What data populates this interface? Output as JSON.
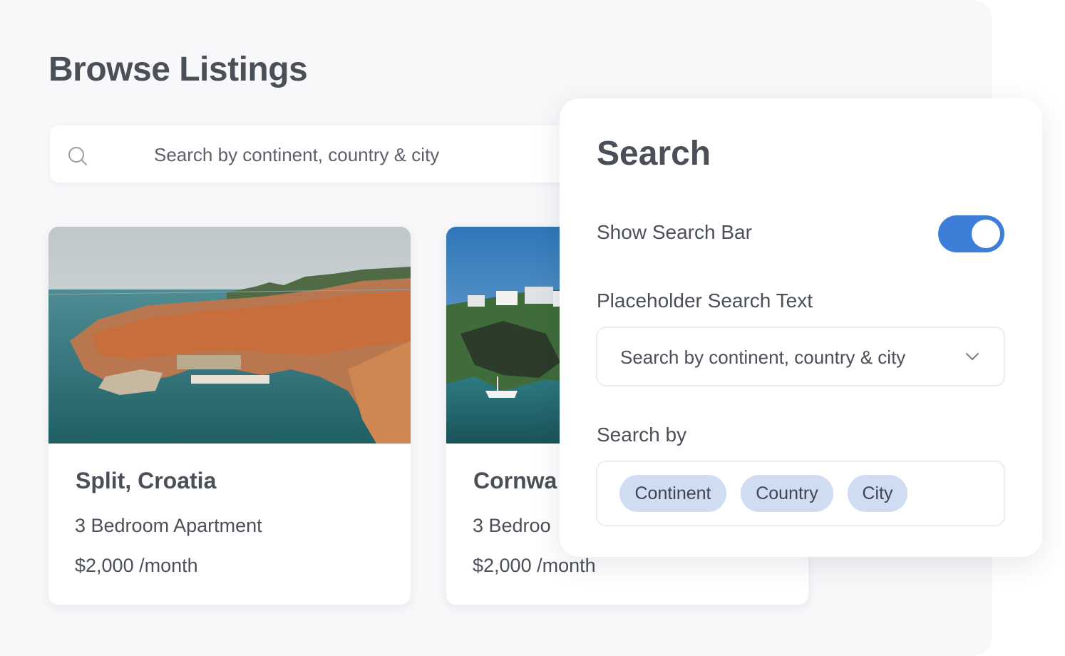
{
  "page": {
    "title": "Browse Listings"
  },
  "search": {
    "placeholder": "Search by continent, country & city"
  },
  "listings": [
    {
      "title": "Split, Croatia",
      "description": "3 Bedroom Apartment",
      "price": "$2,000 /month"
    },
    {
      "title": "Cornwa",
      "description": "3 Bedroo",
      "price": "$2,000 /month"
    }
  ],
  "panel": {
    "title": "Search",
    "show_search_bar_label": "Show Search Bar",
    "show_search_bar_on": true,
    "placeholder_label": "Placeholder Search Text",
    "placeholder_value": "Search by continent, country & city",
    "search_by_label": "Search by",
    "search_by_options": [
      "Continent",
      "Country",
      "City"
    ]
  },
  "colors": {
    "accent": "#3d7fd8",
    "chip": "#cfdcf1",
    "text": "#4b4f58"
  },
  "icons": {
    "search": "search-icon",
    "dropdown": "chevron-down-icon"
  }
}
